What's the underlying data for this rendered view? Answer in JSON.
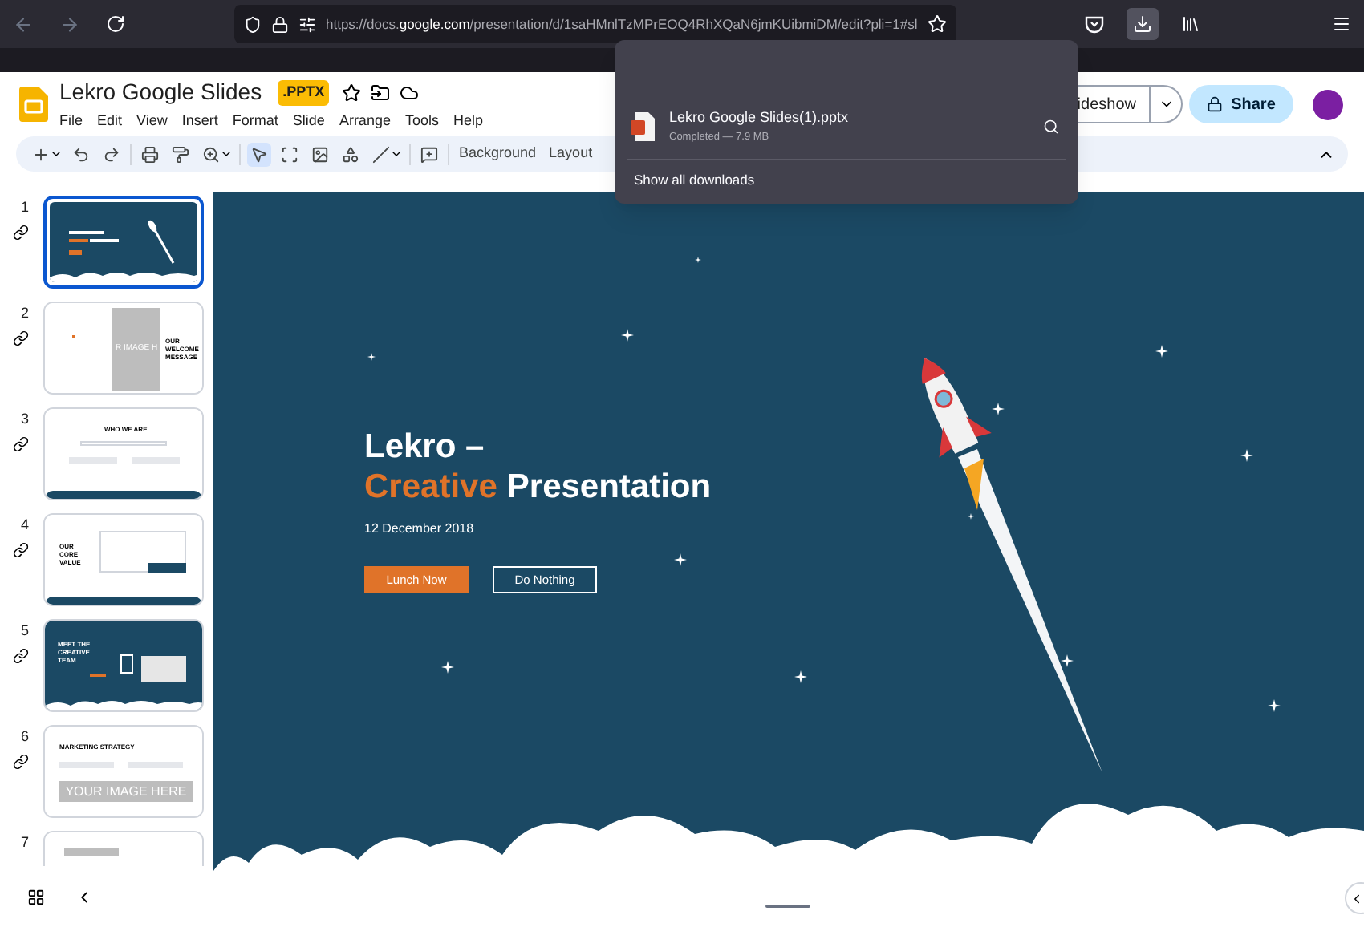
{
  "browser": {
    "url": "https://docs.**google.com**/presentation/d/1saHMnlTzMPrEOQ4RhXQaN6jmKUibmiDM/edit?pli=1#sl",
    "download_active": true
  },
  "downloads": {
    "file": "Lekro Google Slides(1).pptx",
    "status": "Completed — 7.9 MB",
    "link": "Show all downloads"
  },
  "doc": {
    "title": "Lekro Google Slides",
    "badge": ".PPTX",
    "starred": false,
    "menu": [
      "File",
      "Edit",
      "View",
      "Insert",
      "Format",
      "Slide",
      "Arrange",
      "Tools",
      "Help"
    ],
    "slideshow_label": "ideshow",
    "share_label": "Share"
  },
  "toolbar": {
    "tools": [
      {
        "kind": "insert",
        "selected": false
      },
      {
        "kind": "undo",
        "selected": false
      },
      {
        "kind": "redo",
        "selected": false
      },
      {
        "kind": "print",
        "selected": false
      },
      {
        "kind": "paint",
        "selected": false
      },
      {
        "kind": "zoom",
        "selected": false
      },
      {
        "kind": "pointer",
        "selected": true
      },
      {
        "kind": "frame",
        "selected": false
      },
      {
        "kind": "image",
        "selected": false
      },
      {
        "kind": "shapes",
        "selected": false
      },
      {
        "kind": "line",
        "selected": false
      },
      {
        "kind": "comment",
        "selected": false
      }
    ],
    "buttons": [
      "Background",
      "Layout"
    ]
  },
  "slides": [
    {
      "number": "1",
      "kind": "title",
      "selected": true
    },
    {
      "number": "2",
      "kind": "image-left",
      "title": "OUR WELCOME MESSAGE",
      "image_text": "R IMAGE H",
      "selected": false
    },
    {
      "number": "3",
      "kind": "text",
      "title": "WHO WE ARE",
      "selected": false
    },
    {
      "number": "4",
      "kind": "value",
      "title": "OUR CORE VALUE",
      "selected": false
    },
    {
      "number": "5",
      "kind": "team",
      "title": "MEET THE CREATIVE TEAM",
      "selected": false
    },
    {
      "number": "6",
      "kind": "image-bottom",
      "title": "MARKETING STRATEGY",
      "image_text": "YOUR IMAGE HERE",
      "selected": false
    },
    {
      "number": "7",
      "kind": "blank",
      "selected": false
    }
  ],
  "slide": {
    "title_line1": "Lekro –",
    "title_accent": "Creative",
    "title_rest": "Presentation",
    "date": "12 December 2018",
    "buttons": [
      {
        "label": "Lunch Now",
        "kind": "filled"
      },
      {
        "label": "Do Nothing",
        "kind": "outline"
      }
    ]
  }
}
